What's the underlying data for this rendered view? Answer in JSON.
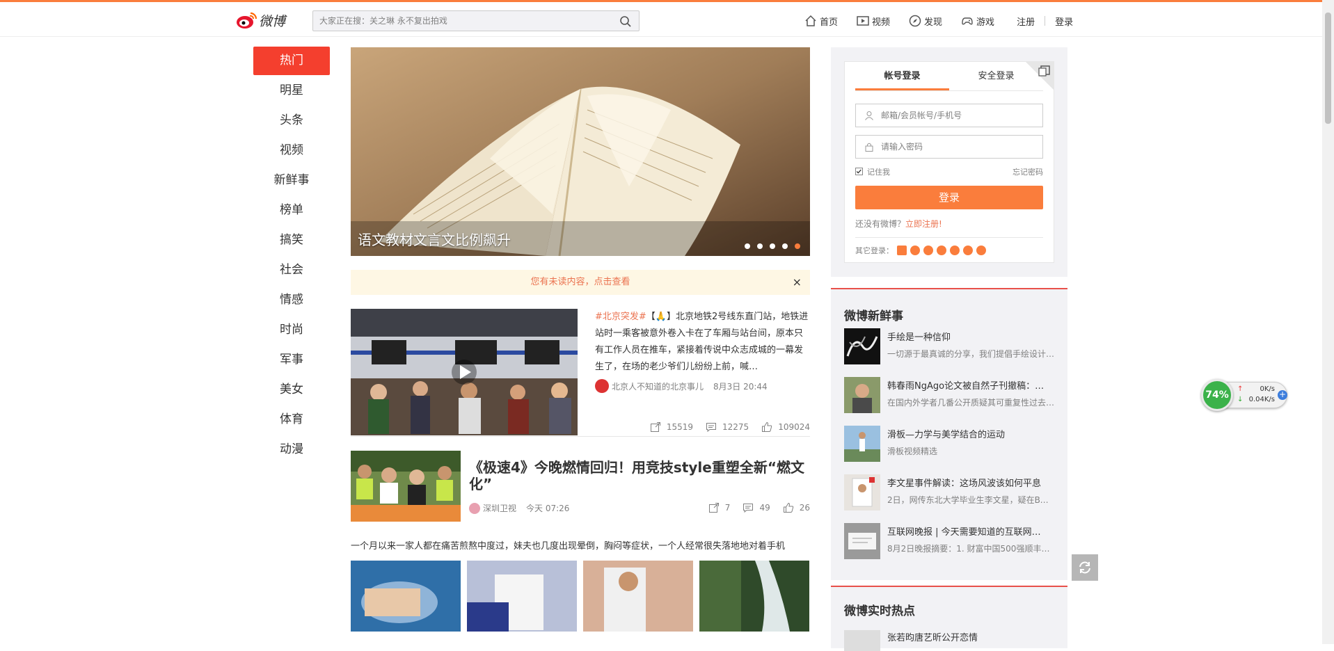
{
  "header": {
    "logo_text": "微博",
    "search_placeholder": "大家正在搜：关之琳 永不复出拍戏",
    "nav": [
      {
        "label": "首页",
        "icon": "home-icon"
      },
      {
        "label": "视频",
        "icon": "video-icon"
      },
      {
        "label": "发现",
        "icon": "compass-icon"
      },
      {
        "label": "游戏",
        "icon": "gamepad-icon"
      }
    ],
    "register_label": "注册",
    "login_label": "登录"
  },
  "leftnav": {
    "items": [
      "热门",
      "明星",
      "头条",
      "视频",
      "新鲜事",
      "榜单",
      "搞笑",
      "社会",
      "情感",
      "时尚",
      "军事",
      "美女",
      "体育",
      "动漫"
    ],
    "active_index": 0
  },
  "banner": {
    "title": "语文教材文言文比例飙升",
    "slide_count": 5,
    "active_slide": 5
  },
  "unread": {
    "text": "您有未读内容，点击查看",
    "close": "×"
  },
  "feed": {
    "item1": {
      "tag": "#北京突发#",
      "text": "【🙏】北京地铁2号线东直门站，地铁进站时一乘客被意外卷入卡在了车厢与站台间，原本只有工作人员在推车，紧接着传说中众志成城的一幕发生了，在场的老少爷们儿纷纷上前，喊…",
      "author": "北京人不知道的北京事儿",
      "time": "8月3日 20:44",
      "reposts": "15519",
      "comments": "12275",
      "likes": "109024"
    },
    "item2": {
      "title": "《极速4》今晚燃情回归！用竞技style重塑全新“燃文化”",
      "author": "深圳卫视",
      "time": "今天 07:26",
      "reposts": "7",
      "comments": "49",
      "likes": "26"
    },
    "item3": {
      "text": "一个月以来一家人都在痛苦煎熬中度过，妹夫也几度出现晕倒，胸闷等症状，一个人经常很失落地地对着手机"
    }
  },
  "login": {
    "tab_account": "帐号登录",
    "tab_secure": "安全登录",
    "username_placeholder": "邮箱/会员帐号/手机号",
    "password_placeholder": "请输入密码",
    "remember": "记住我",
    "forgot": "忘记密码",
    "button": "登录",
    "no_account": "还没有微博？",
    "register_link": "立即注册!",
    "other_login": "其它登录："
  },
  "news": {
    "title": "微博新鲜事",
    "items": [
      {
        "title": "手绘是一种信仰",
        "desc": "一切源于最真诚的分享，我们提倡手绘设计…"
      },
      {
        "title": "韩春雨NgAgo论文被自然子刊撤稿：…",
        "desc": "在国内外学者几番公开质疑其可重复性过去…"
      },
      {
        "title": "滑板—力学与美学结合的运动",
        "desc": "滑板视频精选"
      },
      {
        "title": "李文星事件解读：这场风波该如何平息",
        "desc": "2日，网传东北大学毕业生李文星，疑在BO…"
      },
      {
        "title": "互联网晚报 | 今天需要知道的互联网…",
        "desc": "8月2日晚报摘要：1. 财富中国500强顺丰首…"
      }
    ]
  },
  "hot": {
    "title": "微博实时热点",
    "first_item": "张若昀唐艺昕公开恋情"
  },
  "speed_widget": {
    "percent": "74%",
    "upload": "0K/s",
    "download": "0.04K/s"
  },
  "colors": {
    "accent": "#fa7d3c",
    "active_nav": "#f43f2e",
    "link": "#eb7350"
  }
}
